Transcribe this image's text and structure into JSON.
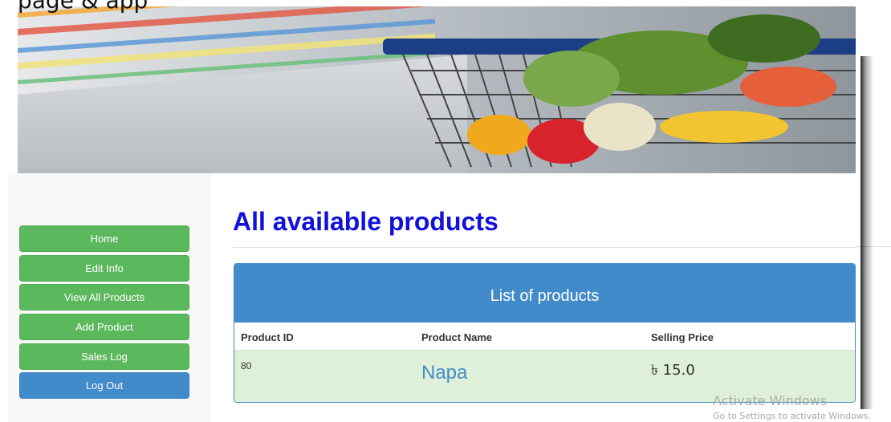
{
  "page": {
    "top_caption": "page & app"
  },
  "sidebar": {
    "items": [
      {
        "label": "Home"
      },
      {
        "label": "Edit Info"
      },
      {
        "label": "View All Products"
      },
      {
        "label": "Add Product"
      },
      {
        "label": "Sales Log"
      },
      {
        "label": "Log Out"
      }
    ]
  },
  "main": {
    "title": "All available products",
    "panel_title": "List of products",
    "columns": [
      "Product ID",
      "Product Name",
      "Selling Price"
    ],
    "rows": [
      {
        "id": "80",
        "name": "Napa",
        "price": "৳ 15.0"
      }
    ]
  },
  "watermark": {
    "line1": "Activate Windows",
    "line2": "Go to Settings to activate Windows."
  },
  "colors": {
    "success": "#5cb85c",
    "primary": "#428bca",
    "title": "#1111dd",
    "row_success": "#dff0d8"
  }
}
